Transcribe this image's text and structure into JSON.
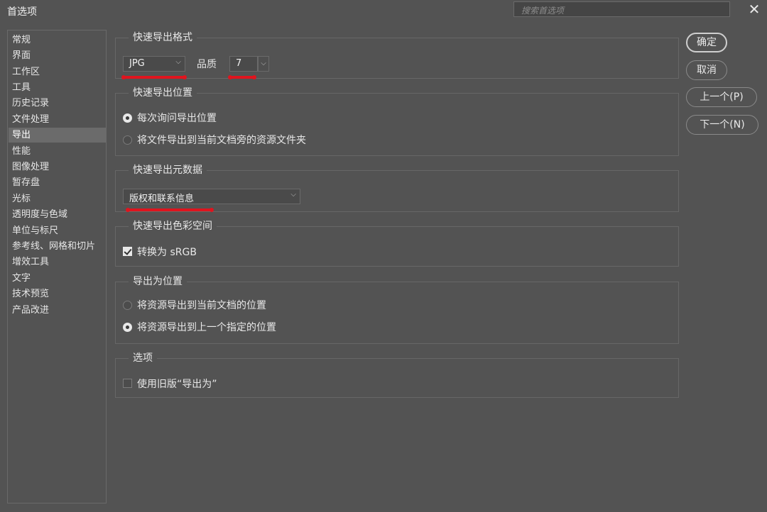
{
  "window": {
    "title": "首选项",
    "search_placeholder": "搜索首选项"
  },
  "sidebar": {
    "items": [
      {
        "label": "常规",
        "active": false
      },
      {
        "label": "界面",
        "active": false
      },
      {
        "label": "工作区",
        "active": false
      },
      {
        "label": "工具",
        "active": false
      },
      {
        "label": "历史记录",
        "active": false
      },
      {
        "label": "文件处理",
        "active": false
      },
      {
        "label": "导出",
        "active": true
      },
      {
        "label": "性能",
        "active": false
      },
      {
        "label": "图像处理",
        "active": false
      },
      {
        "label": "暂存盘",
        "active": false
      },
      {
        "label": "光标",
        "active": false
      },
      {
        "label": "透明度与色域",
        "active": false
      },
      {
        "label": "单位与标尺",
        "active": false
      },
      {
        "label": "参考线、网格和切片",
        "active": false
      },
      {
        "label": "增效工具",
        "active": false
      },
      {
        "label": "文字",
        "active": false
      },
      {
        "label": "技术预览",
        "active": false
      },
      {
        "label": "产品改进",
        "active": false
      }
    ]
  },
  "quick_export_format": {
    "title": "快速导出格式",
    "format_value": "JPG",
    "quality_label": "品质",
    "quality_value": "7"
  },
  "quick_export_location": {
    "title": "快速导出位置",
    "options": [
      {
        "label": "每次询问导出位置",
        "selected": true
      },
      {
        "label": "将文件导出到当前文档旁的资源文件夹",
        "selected": false
      }
    ]
  },
  "quick_export_metadata": {
    "title": "快速导出元数据",
    "value": "版权和联系信息"
  },
  "quick_export_color": {
    "title": "快速导出色彩空间",
    "convert_label": "转换为 sRGB",
    "convert_checked": true
  },
  "export_as_location": {
    "title": "导出为位置",
    "options": [
      {
        "label": "将资源导出到当前文档的位置",
        "selected": false
      },
      {
        "label": "将资源导出到上一个指定的位置",
        "selected": true
      }
    ]
  },
  "options": {
    "title": "选项",
    "legacy_label": "使用旧版“导出为”",
    "legacy_checked": false
  },
  "buttons": {
    "ok": "确定",
    "cancel": "取消",
    "prev": "上一个(P)",
    "next": "下一个(N)"
  },
  "icons": {
    "close": "close-icon",
    "dropdown": "chevron-down-icon"
  },
  "colors": {
    "background": "#535353",
    "annotation_red": "#e0141e"
  }
}
